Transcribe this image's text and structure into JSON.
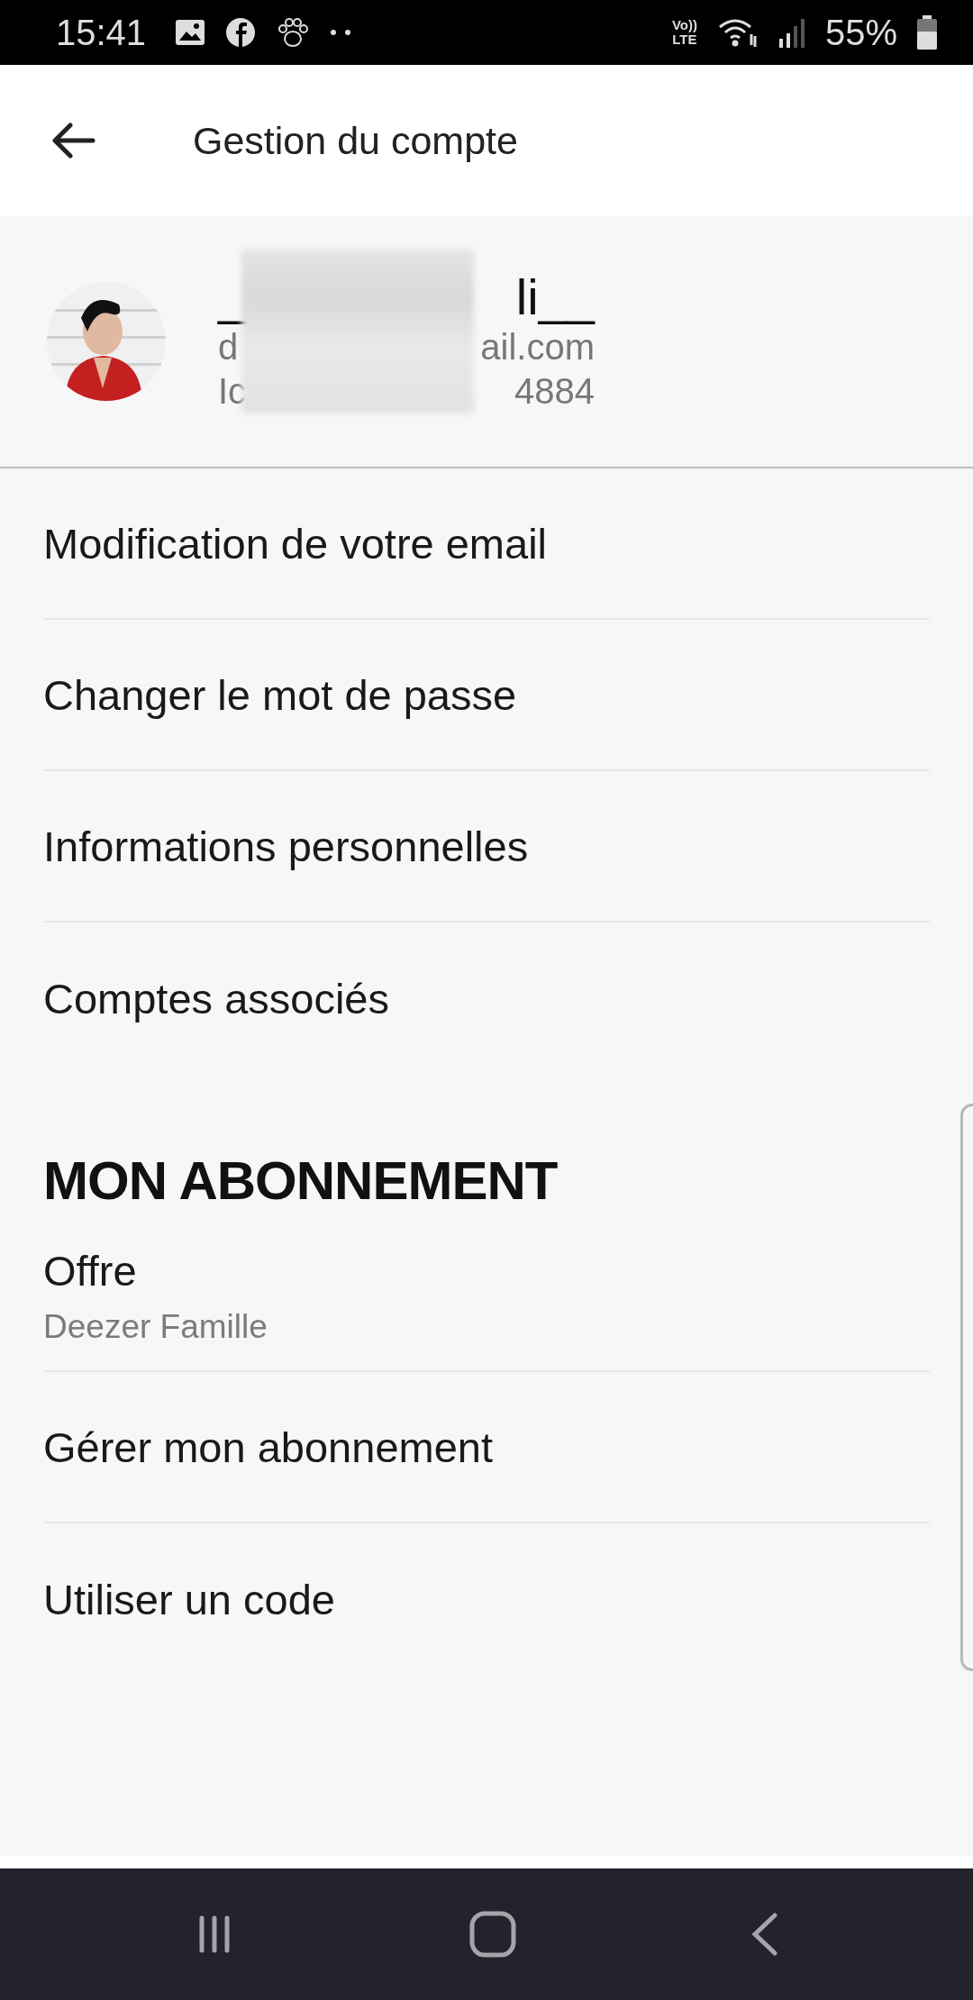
{
  "status_bar": {
    "time": "15:41",
    "volte_top": "Vo))",
    "volte_bottom": "LTE",
    "battery": "55%"
  },
  "app_bar": {
    "title": "Gestion du compte"
  },
  "profile": {
    "lines": [
      {
        "kind": "name",
        "start": "_",
        "end": "li__"
      },
      {
        "kind": "detail",
        "start": "d",
        "end": "ail.com"
      },
      {
        "kind": "detail",
        "start": "Ic",
        "end": "4884"
      }
    ]
  },
  "account_items": [
    {
      "label": "Modification de votre email"
    },
    {
      "label": "Changer le mot de passe"
    },
    {
      "label": "Informations personnelles"
    },
    {
      "label": "Comptes associés"
    }
  ],
  "subscription": {
    "heading": "MON ABONNEMENT",
    "items": [
      {
        "label": "Offre",
        "detail": "Deezer Famille"
      },
      {
        "label": "Gérer mon abonnement"
      },
      {
        "label": "Utiliser un code"
      }
    ]
  }
}
